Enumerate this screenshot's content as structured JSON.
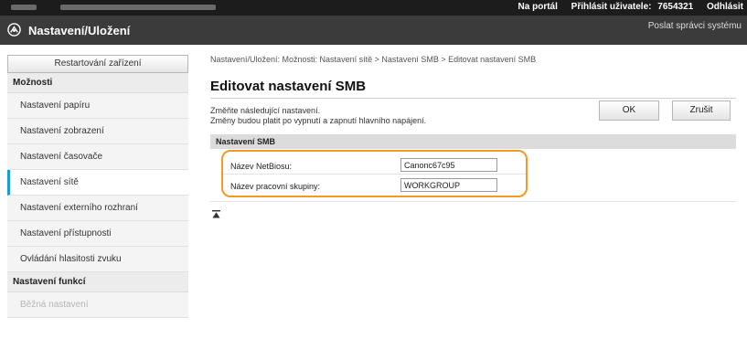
{
  "topbar": {
    "portal_label": "Na portál",
    "login_label": "Přihlásit uživatele:",
    "user_id": "7654321",
    "logout_label": "Odhlásit"
  },
  "titlebar": {
    "app_title": "Nastavení/Uložení",
    "admin_link": "Poslat správci systému",
    "icon": "settings-icon"
  },
  "sidebar": {
    "restart_label": "Restartování zařízení",
    "section_options": "Možnosti",
    "items": [
      {
        "label": "Nastavení papíru",
        "active": false
      },
      {
        "label": "Nastavení zobrazení",
        "active": false
      },
      {
        "label": "Nastavení časovače",
        "active": false
      },
      {
        "label": "Nastavení sítě",
        "active": true
      },
      {
        "label": "Nastavení externího rozhraní",
        "active": false
      },
      {
        "label": "Nastavení přístupnosti",
        "active": false
      },
      {
        "label": "Ovládání hlasitosti zvuku",
        "active": false
      }
    ],
    "section_functions": "Nastavení funkcí",
    "function_items": [
      {
        "label": "Běžná nastavení"
      }
    ]
  },
  "main": {
    "breadcrumb": "Nastavení/Uložení: Možnosti: Nastavení sítě > Nastavení SMB > Editovat nastavení SMB",
    "page_title": "Editovat nastavení SMB",
    "instruction_line1": "Změňte následující nastavení.",
    "instruction_line2": "Změny budou platit po vypnutí a zapnutí hlavního napájení.",
    "ok_label": "OK",
    "cancel_label": "Zrušit",
    "section_title": "Nastavení SMB",
    "fields": {
      "netbios_label": "Název NetBiosu:",
      "netbios_value": "Canonc67c95",
      "workgroup_label": "Název pracovní skupiny:",
      "workgroup_value": "WORKGROUP"
    },
    "top_icon": "scroll-to-top-icon"
  },
  "colors": {
    "highlight_outline": "#f29a26",
    "active_accent": "#1b9bd6",
    "titlebar_bg": "#3b3b3b",
    "topbar_bg": "#1c1c1c"
  }
}
